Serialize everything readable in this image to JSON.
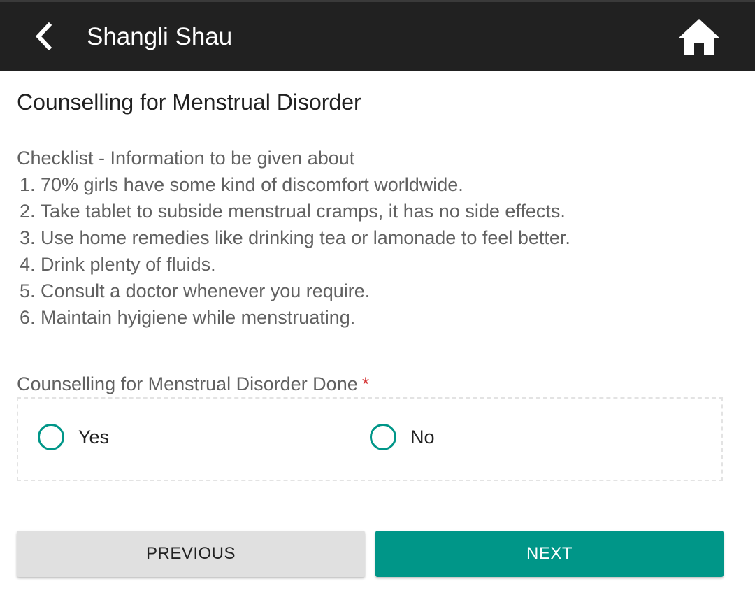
{
  "header": {
    "back_icon": "chevron-left-icon",
    "title": "Shangli Shau",
    "home_icon": "home-icon"
  },
  "form": {
    "heading": "Counselling for Menstrual Disorder",
    "checklist_intro": "Checklist - Information to be given about",
    "checklist_items": [
      "1. 70% girls have some kind of discomfort worldwide.",
      "2. Take tablet to subside menstrual cramps, it has no side effects.",
      "3. Use home remedies like drinking tea or lamonade to feel better.",
      "4. Drink plenty of fluids.",
      "5. Consult a doctor whenever you require.",
      "6. Maintain hyigiene while menstruating."
    ],
    "question_label": "Counselling for Menstrual Disorder Done",
    "required_mark": "*",
    "options": [
      {
        "label": "Yes",
        "selected": false
      },
      {
        "label": "No",
        "selected": false
      }
    ]
  },
  "buttons": {
    "previous": "PREVIOUS",
    "next": "NEXT"
  },
  "colors": {
    "toolbar": "#212121",
    "accent": "#009688",
    "required": "#d32f2f"
  }
}
